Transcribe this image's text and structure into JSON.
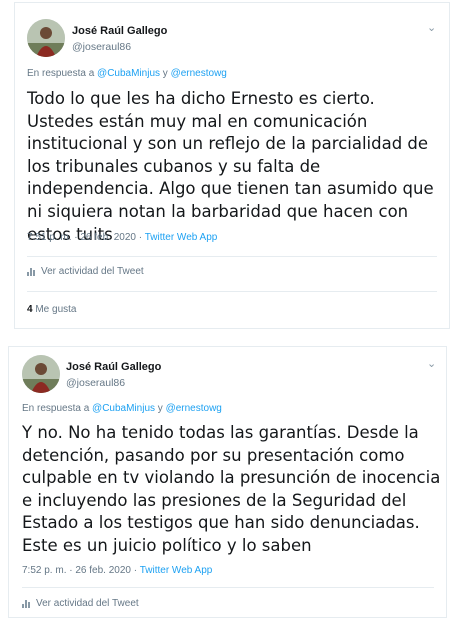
{
  "tweets": [
    {
      "name": "José Raúl Gallego",
      "handle": "@joseraul86",
      "reply_prefix": "En respuesta a",
      "reply_user1": "@CubaMinjus",
      "reply_and": "y",
      "reply_user2": "@ernestowg",
      "text": "Todo lo que les ha dicho Ernesto es cierto. Ustedes están muy mal en comunicación institucional y son un reflejo de la parcialidad de los tribunales cubanos y su falta de independencia. Algo que tienen tan asumido que ni siquiera notan la barbaridad que hacen con estos tuits",
      "time": "7:51 p. m. · 26 feb. 2020",
      "sep": "·",
      "source": "Twitter Web App",
      "activity": "Ver actividad del Tweet",
      "likes_count": "4",
      "likes_label": "Me gusta"
    },
    {
      "name": "José Raúl Gallego",
      "handle": "@joseraul86",
      "reply_prefix": "En respuesta a",
      "reply_user1": "@CubaMinjus",
      "reply_and": "y",
      "reply_user2": "@ernestowg",
      "text": "Y no. No ha tenido todas las garantías. Desde la detención, pasando por su presentación como culpable en tv violando la presunción de inocencia e incluyendo las presiones de la Seguridad del Estado a los testigos que han sido denunciadas. Este es un juicio político y lo saben",
      "time": "7:52 p. m. · 26 feb. 2020",
      "sep": "·",
      "source": "Twitter Web App",
      "activity": "Ver actividad del Tweet"
    }
  ],
  "icons": {
    "more": "chevron-down-icon",
    "activity": "bar-chart-icon"
  },
  "colors": {
    "link": "#1da1f2",
    "secondary": "#657786",
    "text": "#14171a",
    "border": "#e6ecf0"
  }
}
